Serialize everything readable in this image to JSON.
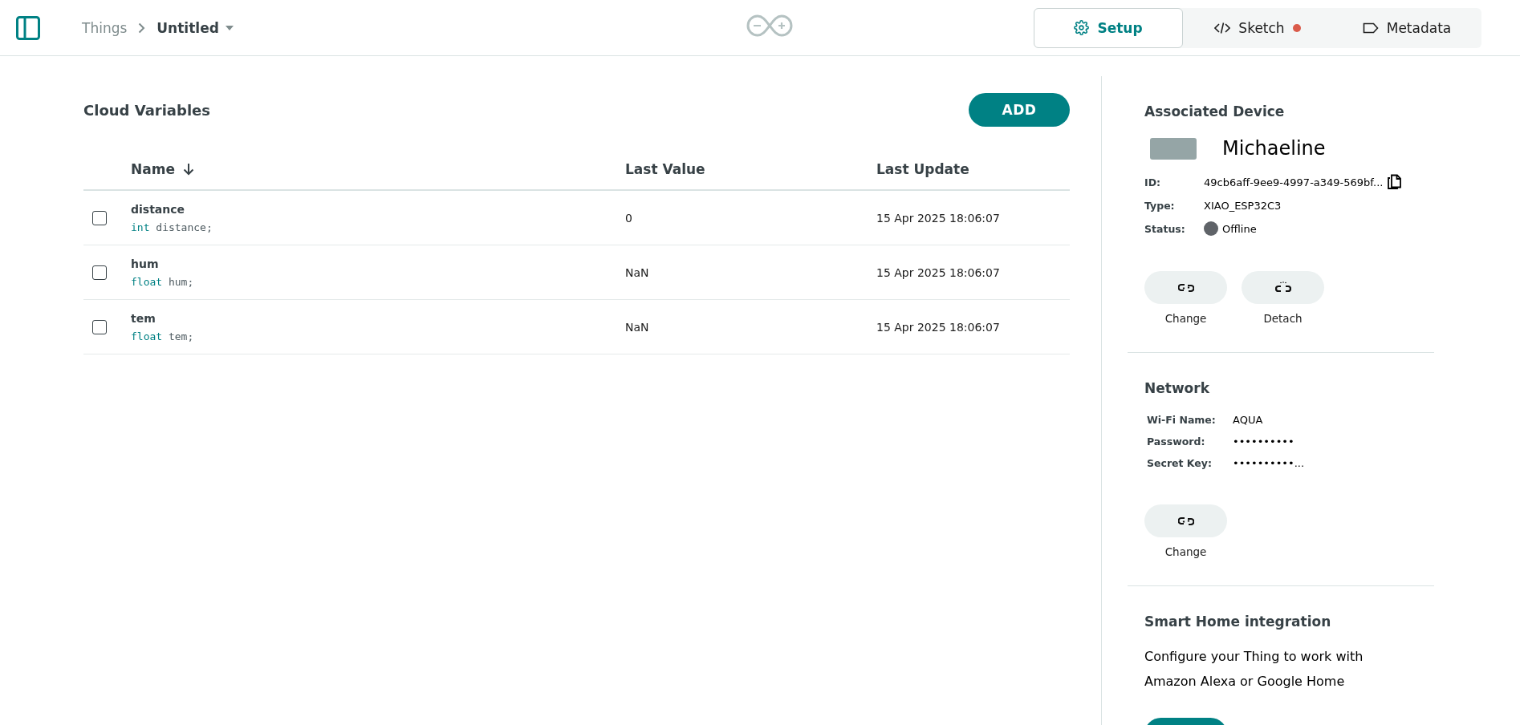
{
  "header": {
    "breadcrumb": [
      {
        "label": "Things",
        "current": false
      },
      {
        "label": "Untitled",
        "current": true
      }
    ],
    "tabs": [
      {
        "label": "Setup",
        "selected": true,
        "kind": "setup",
        "unsaved": false
      },
      {
        "label": "Sketch",
        "selected": false,
        "kind": "sketch",
        "unsaved": true
      },
      {
        "label": "Metadata",
        "selected": false,
        "kind": "metadata",
        "unsaved": false
      }
    ]
  },
  "variables": {
    "title": "Cloud Variables",
    "add_button": "ADD",
    "columns": [
      {
        "label": "Name",
        "sorted": true
      },
      {
        "label": "Last Value",
        "sorted": false
      },
      {
        "label": "Last Update",
        "sorted": false
      }
    ],
    "rows": [
      {
        "checked": false,
        "name": "distance",
        "declaration": "int distance;",
        "last_value": "0",
        "last_update": "15 Apr 2025 18:06:07"
      },
      {
        "checked": false,
        "name": "hum",
        "declaration": "float hum;",
        "last_value": "NaN",
        "last_update": "15 Apr 2025 18:06:07"
      },
      {
        "checked": false,
        "name": "tem",
        "declaration": "float tem;",
        "last_value": "NaN",
        "last_update": "15 Apr 2025 18:06:07"
      }
    ]
  },
  "device": {
    "title": "Associated Device",
    "name": "Michaeline",
    "fields": [
      {
        "kind": "copy",
        "label": "ID:",
        "value": "49cb6aff-9ee9-4997-a349-569bf..."
      },
      {
        "kind": "text",
        "label": "Type:",
        "value": "XIAO_ESP32C3"
      },
      {
        "kind": "status",
        "label": "Status:",
        "value": "Offline",
        "color": "#5f6368"
      }
    ],
    "actions": [
      {
        "kind": "change",
        "label": "Change"
      },
      {
        "kind": "detach",
        "label": "Detach"
      }
    ]
  },
  "network": {
    "title": "Network",
    "fields": [
      {
        "kind": "text",
        "label": "Wi-Fi Name:",
        "value": "AQUA"
      },
      {
        "kind": "text",
        "label": "Password:",
        "value": "••••••••••"
      },
      {
        "kind": "text",
        "label": "Secret Key:",
        "value": "••••••••••..."
      }
    ],
    "actions": [
      {
        "kind": "change",
        "label": "Change"
      }
    ]
  },
  "smart_home": {
    "title": "Smart Home integration",
    "description": "Configure your Thing to work with Amazon Alexa or Google Home"
  }
}
